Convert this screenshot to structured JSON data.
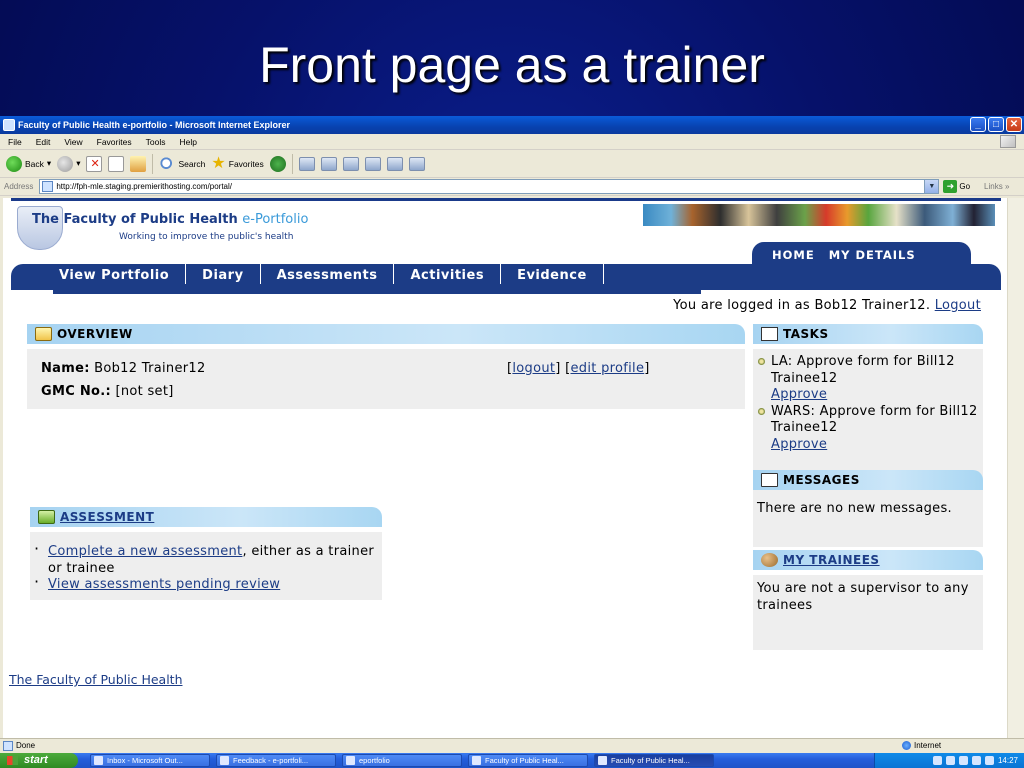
{
  "slide": {
    "title": "Front page as a trainer"
  },
  "browser": {
    "title": "Faculty of Public Health e-portfolio - Microsoft Internet Explorer",
    "menu": [
      "File",
      "Edit",
      "View",
      "Favorites",
      "Tools",
      "Help"
    ],
    "toolbar": {
      "back": "Back",
      "search": "Search",
      "favorites": "Favorites"
    },
    "address_label": "Address",
    "url": "http://fph-mle.staging.premierithosting.com/portal/",
    "go": "Go",
    "links": "Links",
    "status": "Done",
    "zone": "Internet"
  },
  "site": {
    "title_main": "The Faculty of Public Health",
    "title_accent": "e-Portfolio",
    "tagline": "Working to improve the public's health",
    "top_nav": [
      "HOME",
      "MY DETAILS"
    ],
    "main_nav": [
      "View Portfolio",
      "Diary",
      "Assessments",
      "Activities",
      "Evidence"
    ],
    "logged_in_text": "You are logged in as Bob12 Trainer12.",
    "logout": "Logout"
  },
  "overview": {
    "heading": "OVERVIEW",
    "name_label": "Name:",
    "name_value": "Bob12 Trainer12",
    "gmc_label": "GMC No.:",
    "gmc_value": "[not set]",
    "logout_link": "logout",
    "edit_profile_link": "edit profile"
  },
  "assessment": {
    "heading": "ASSESSMENT",
    "item1_link": "Complete a new assessment",
    "item1_rest": ", either as a trainer or trainee",
    "item2_link": "View assessments pending review"
  },
  "tasks": {
    "heading": "TASKS",
    "items": [
      {
        "text": "LA: Approve form for Bill12 Trainee12",
        "action": "Approve"
      },
      {
        "text": "WARS: Approve form for Bill12 Trainee12",
        "action": "Approve"
      }
    ]
  },
  "messages": {
    "heading": "MESSAGES",
    "body": "There are no new messages."
  },
  "my_trainees": {
    "heading": "MY TRAINEES",
    "body": "You are not a supervisor to any trainees"
  },
  "footer": {
    "link": "The Faculty of Public Health"
  },
  "taskbar": {
    "start": "start",
    "items": [
      "Inbox - Microsoft Out...",
      "Feedback - e-portfoli...",
      "eportfolio",
      "Faculty of Public Heal...",
      "Faculty of Public Heal..."
    ],
    "clock": "14:27"
  },
  "colors": {
    "nav": "#1c3c86",
    "panel_head": "#a6d3f1",
    "panel_body": "#eeeeee",
    "slide_bg": "#06116a"
  }
}
